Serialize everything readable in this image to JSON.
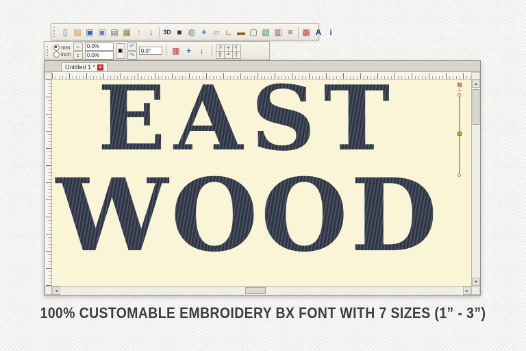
{
  "colors": {
    "canvas_bg": "#FBF5D8",
    "thread": "#353C4B",
    "gold_accent": "#C2A14A",
    "close_red": "#CC2A2A"
  },
  "toolbar_main": {
    "items": [
      {
        "button": "new-document-button",
        "icon": "new-document-icon",
        "glyph": "▯",
        "color": "#5a5a5a"
      },
      {
        "button": "open-file-button",
        "icon": "open-folder-icon",
        "glyph": "▨",
        "color": "#c8922b"
      },
      {
        "button": "save-button",
        "icon": "save-icon",
        "glyph": "▣",
        "color": "#3a5fa8"
      },
      {
        "button": "save-all-button",
        "icon": "save-all-icon",
        "glyph": "▣",
        "color": "#6a7fb0"
      },
      {
        "button": "copy-button",
        "icon": "copy-icon",
        "glyph": "▤",
        "color": "#6a6a6a"
      },
      {
        "button": "paste-button",
        "icon": "paste-icon",
        "glyph": "▦",
        "color": "#8a7a3a"
      },
      {
        "button": "stitch-forward-button",
        "icon": "arrow-up-icon",
        "glyph": "↑",
        "color": "#c8922b",
        "bold": true
      },
      {
        "button": "stitch-back-button",
        "icon": "arrow-down-icon",
        "glyph": "↓",
        "color": "#3a5fa8",
        "bold": true
      },
      {
        "sep": true
      },
      {
        "button": "3d-view-button",
        "icon": "3d-view-label",
        "glyph": "3D",
        "color": "#1d2f7c",
        "bold": true
      },
      {
        "button": "design-view-button",
        "icon": "design-view-icon",
        "glyph": "■",
        "color": "#3b3b3b"
      },
      {
        "button": "zoom-button",
        "icon": "zoom-icon",
        "glyph": "◎",
        "color": "#444444"
      },
      {
        "button": "move-button",
        "icon": "move-icon",
        "glyph": "+",
        "color": "#2a6fb8",
        "bold": true
      },
      {
        "button": "eraser-button",
        "icon": "eraser-icon",
        "glyph": "▱",
        "color": "#a05a8a"
      },
      {
        "button": "measure-button",
        "icon": "measure-icon",
        "glyph": "∟",
        "color": "#b03a3a"
      },
      {
        "button": "ruler-button",
        "icon": "ruler-icon",
        "glyph": "▬",
        "color": "#8a6a2a"
      },
      {
        "button": "frame-button",
        "icon": "frame-icon",
        "glyph": "▢",
        "color": "#555555"
      },
      {
        "button": "image-button",
        "icon": "image-icon",
        "glyph": "▧",
        "color": "#3a8a5a"
      },
      {
        "button": "chart-button",
        "icon": "chart-icon",
        "glyph": "▥",
        "color": "#8a3a8a"
      },
      {
        "button": "list-button",
        "icon": "list-icon",
        "glyph": "≡",
        "color": "#555555",
        "bold": true
      },
      {
        "sep": true
      },
      {
        "button": "palette-button",
        "icon": "palette-icon",
        "glyph": "▩",
        "color": "#c03a3a"
      },
      {
        "button": "text-tool-button",
        "icon": "letter-a-icon",
        "glyph": "A",
        "color": "#1a3ab0",
        "bold": true
      },
      {
        "button": "info-button",
        "icon": "info-icon",
        "glyph": "i",
        "color": "#7a3ab0",
        "bold": true
      }
    ]
  },
  "toolbar_settings": {
    "unit_mm": "mm",
    "unit_inch": "inch",
    "scale_x": "0.0%",
    "scale_y": "0.0%",
    "angle": "0.0°",
    "width_glyph": "↔",
    "height_glyph": "↕",
    "lock_glyph": "▣",
    "rotate_left_glyph": "↶",
    "rotate_right_glyph": "↷",
    "tools": [
      {
        "button": "colors-button",
        "icon": "colors-icon",
        "glyph": "▦",
        "color": "#c03a3a"
      },
      {
        "button": "center-design-button",
        "icon": "move-cross-icon",
        "glyph": "+",
        "color": "#2a6fb8",
        "bold": true
      },
      {
        "button": "needle-point-button",
        "icon": "needle-icon",
        "glyph": "↓",
        "color": "#cc2222",
        "bold": true
      }
    ],
    "align": [
      {
        "button": "align-left-button",
        "icon": "align-left-icon",
        "glyph": "╞"
      },
      {
        "button": "align-top-button",
        "icon": "align-top-icon",
        "glyph": "╤"
      },
      {
        "button": "align-right-button",
        "icon": "align-right-icon",
        "glyph": "╡"
      },
      {
        "button": "align-middle-h-button",
        "icon": "align-middle-h-icon",
        "glyph": "╟"
      },
      {
        "button": "align-bottom-button",
        "icon": "align-bottom-icon",
        "glyph": "╧"
      },
      {
        "button": "align-middle-v-button",
        "icon": "align-middle-v-icon",
        "glyph": "╢"
      }
    ]
  },
  "window": {
    "tab_title": "Untitled 1 *",
    "tab_close": "×",
    "compass": "N",
    "compass_cross": "┼"
  },
  "design": {
    "line1": "EAST",
    "line2": "WOOD"
  },
  "scroll": {
    "up": "▲",
    "down": "▼",
    "left": "◄",
    "right": "►"
  },
  "caption": {
    "text": "100% CUSTOMABLE EMBROIDERY BX FONT WITH 7 SIZES (1” -  3”)"
  }
}
